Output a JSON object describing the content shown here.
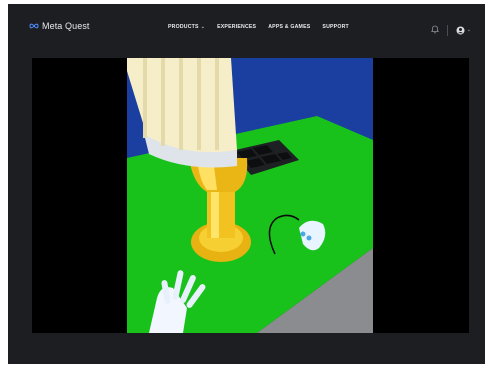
{
  "brand": {
    "name": "Meta Quest",
    "logo_icon": "meta-infinity-icon"
  },
  "nav": {
    "items": [
      {
        "label": "PRODUCTS",
        "has_dropdown": true,
        "icon": "chevron-down-icon"
      },
      {
        "label": "EXPERIENCES",
        "has_dropdown": false
      },
      {
        "label": "APPS & GAMES",
        "has_dropdown": false
      },
      {
        "label": "SUPPORT",
        "has_dropdown": false
      }
    ]
  },
  "header_icons": {
    "notifications": "bell-icon",
    "account": "user-avatar-icon",
    "account_menu": "chevron-down-icon"
  },
  "video": {
    "scene": "VR hand interacting with a yellow lamp-like tool on a green table"
  },
  "colors": {
    "page_bg": "#1c1e21",
    "player_bg": "#000000",
    "nav_text": "#e8eaed",
    "scene_wall": "#1a3fa0",
    "scene_table": "#19c21b",
    "scene_tool": "#f2c320"
  }
}
